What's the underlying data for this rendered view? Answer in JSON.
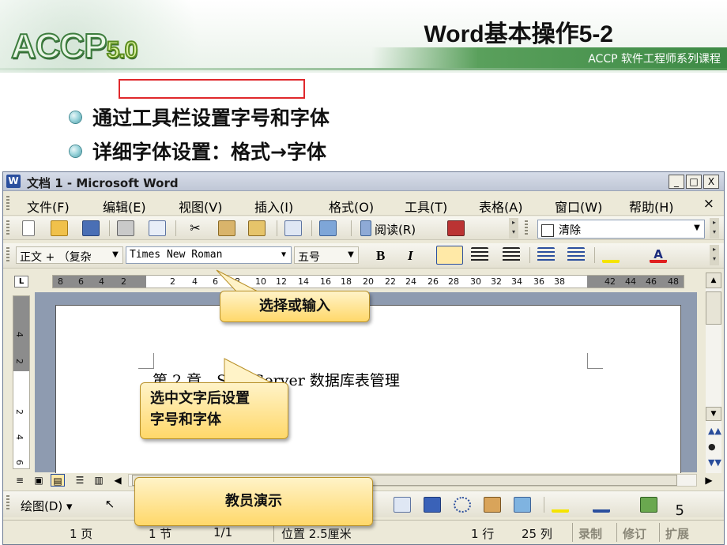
{
  "slide": {
    "logo": "ACCP",
    "logo_version": "5.0",
    "title": "Word基本操作5-2",
    "course": "ACCP 软件工程师系列课程",
    "bullets": [
      "通过工具栏设置字号和字体",
      "详细字体设置：格式→字体"
    ],
    "page_number": "5"
  },
  "window": {
    "title": "文档 1 - Microsoft Word",
    "buttons": [
      "_",
      "□",
      "X"
    ]
  },
  "menu": {
    "items": [
      "文件(F)",
      "编辑(E)",
      "视图(V)",
      "插入(I)",
      "格式(O)",
      "工具(T)",
      "表格(A)",
      "窗口(W)",
      "帮助(H)"
    ],
    "close_doc": "×"
  },
  "standard_toolbar": {
    "read_label": "阅读(R)",
    "clear_label": "清除"
  },
  "format_toolbar": {
    "style_value": "正文 + （复杂",
    "font_name": "Times New Roman",
    "font_size": "五号",
    "bold": "B",
    "italic": "I"
  },
  "ruler": {
    "corner": "L",
    "ticks": [
      "8",
      "6",
      "4",
      "2",
      "2",
      "4",
      "6",
      "8",
      "10",
      "12",
      "14",
      "16",
      "18",
      "20",
      "22",
      "24",
      "26",
      "28",
      "30",
      "32",
      "34",
      "36",
      "38",
      "42",
      "44",
      "46",
      "48"
    ],
    "v_ticks": [
      "4",
      "2",
      "2",
      "4",
      "6"
    ]
  },
  "document": {
    "text": "第 2 章　SQL Server 数据库表管理"
  },
  "drawing_toolbar": {
    "draw_label": "绘图(D) ▾"
  },
  "status_bar": {
    "page": "1 页",
    "section": "1 节",
    "page_of": "1/1",
    "position": "位置 2.5厘米",
    "line": "1 行",
    "column": "25 列",
    "rec": "录制",
    "trk": "修订",
    "ext": "扩展"
  },
  "callouts": {
    "input": "选择或输入",
    "select_line1": "选中文字后设置",
    "select_line2": "字号和字体",
    "demo": "教员演示"
  },
  "colors": {
    "highlight_box": "#e0282c",
    "callout_fill": "#ffd86a",
    "header_band": "#3d8a45"
  }
}
